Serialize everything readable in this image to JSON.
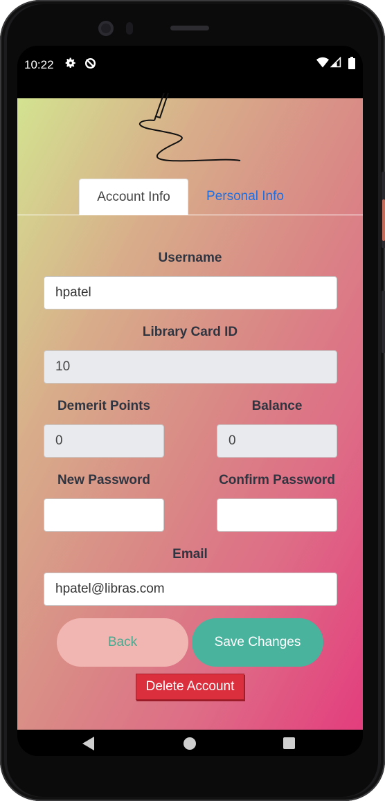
{
  "status_bar": {
    "time": "10:22",
    "icons": [
      "gear-icon",
      "no-sync-icon",
      "wifi-icon",
      "signal-icon",
      "battery-icon"
    ]
  },
  "tabs": [
    {
      "label": "Account Info",
      "active": true
    },
    {
      "label": "Personal Info",
      "active": false
    }
  ],
  "form": {
    "username_label": "Username",
    "username_value": "hpatel",
    "card_label": "Library Card ID",
    "card_value": "10",
    "demerit_label": "Demerit Points",
    "demerit_value": "0",
    "balance_label": "Balance",
    "balance_value": "0",
    "new_password_label": "New Password",
    "new_password_value": "",
    "confirm_password_label": "Confirm Password",
    "confirm_password_value": "",
    "email_label": "Email",
    "email_value": "hpatel@libras.com"
  },
  "buttons": {
    "back": "Back",
    "save": "Save Changes",
    "delete": "Delete Account"
  },
  "colors": {
    "gradient_start": "#d3e390",
    "gradient_end": "#e33d7d",
    "save_button": "#49b39e",
    "back_button": "#f2b6b2",
    "delete_button": "#dc2f3d",
    "tab_link": "#1f6fe0"
  }
}
